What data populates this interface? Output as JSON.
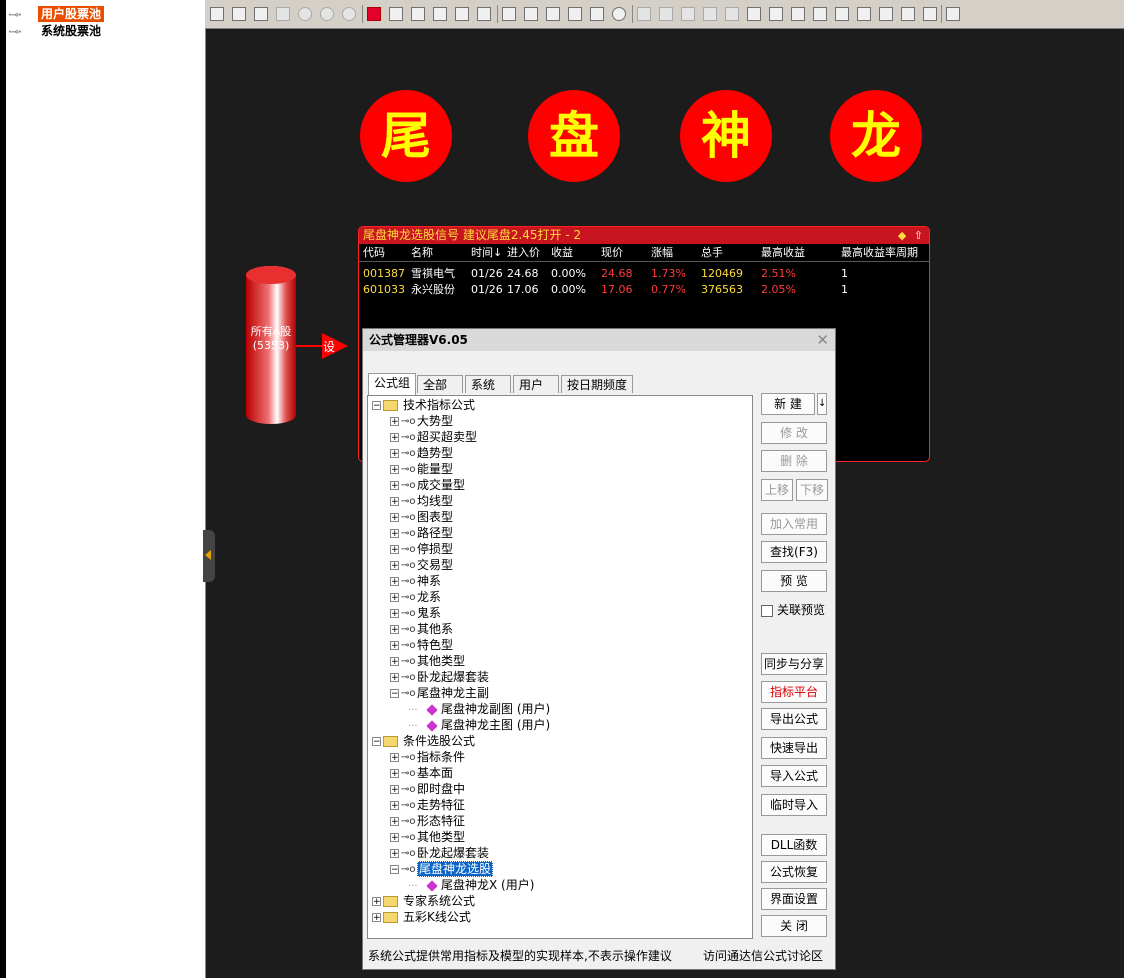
{
  "stock_pools": {
    "items": [
      {
        "label": "用户股票池",
        "selected": true
      },
      {
        "label": "系统股票池",
        "selected": false
      }
    ]
  },
  "toolbar": {
    "icons": [
      "new-icon",
      "open-icon",
      "save-icon",
      "delete-icon",
      "play-icon",
      "pause-icon",
      "stop-icon",
      "pointer-icon",
      "shape-icon",
      "list-icon",
      "triangle-icon",
      "arrow-icon",
      "grid-icon",
      "text-icon",
      "line-icon",
      "rect-icon",
      "rounded-rect-icon",
      "ellipse-icon",
      "circle-icon",
      "copy-icon",
      "paste-icon",
      "clip-icon",
      "fill-icon",
      "color-icon",
      "align-left-icon",
      "align-right-icon",
      "align-top-icon",
      "align-bottom-icon",
      "center-icon",
      "distribute-h-icon",
      "distribute-v-icon",
      "same-width-icon",
      "same-height-icon",
      "chart-icon"
    ]
  },
  "banner": {
    "chars": [
      "尾",
      "盘",
      "神",
      "龙"
    ],
    "color_bg": "#ff0000",
    "color_fg": "#ffff00"
  },
  "result_panel": {
    "title": "尾盘神龙选股信号 建议尾盘2.45打开 - 2",
    "columns": [
      "代码",
      "名称",
      "时间↓",
      "进入价",
      "收益",
      "现价",
      "涨幅",
      "总手",
      "最高收益",
      "最高收益率周期"
    ],
    "rows": [
      {
        "code": "001387",
        "name": "雪祺电气",
        "time": "01/26",
        "entry": "24.68",
        "gain": "0.00%",
        "price": "24.68",
        "change": "1.73%",
        "volume": "120469",
        "max_gain": "2.51%",
        "max_period": "1"
      },
      {
        "code": "601033",
        "name": "永兴股份",
        "time": "01/26",
        "entry": "17.06",
        "gain": "0.00%",
        "price": "17.06",
        "change": "0.77%",
        "volume": "376563",
        "max_gain": "2.05%",
        "max_period": "1"
      }
    ]
  },
  "flow": {
    "source_label": "所有A股",
    "source_count": "(5353)",
    "node_label": "设"
  },
  "dialog": {
    "title": "公式管理器V6.05",
    "tabs": [
      "公式组",
      "全部",
      "系统",
      "用户",
      "按日期频度"
    ],
    "tree": [
      {
        "label": "技术指标公式",
        "level": 0,
        "kind": "folder",
        "expander": "⊟"
      },
      {
        "label": "大势型",
        "level": 1,
        "kind": "key",
        "expander": "⊞"
      },
      {
        "label": "超买超卖型",
        "level": 1,
        "kind": "key",
        "expander": "⊞"
      },
      {
        "label": "趋势型",
        "level": 1,
        "kind": "key",
        "expander": "⊞"
      },
      {
        "label": "能量型",
        "level": 1,
        "kind": "key",
        "expander": "⊞"
      },
      {
        "label": "成交量型",
        "level": 1,
        "kind": "key",
        "expander": "⊞"
      },
      {
        "label": "均线型",
        "level": 1,
        "kind": "key",
        "expander": "⊞"
      },
      {
        "label": "图表型",
        "level": 1,
        "kind": "key",
        "expander": "⊞"
      },
      {
        "label": "路径型",
        "level": 1,
        "kind": "key",
        "expander": "⊞"
      },
      {
        "label": "停损型",
        "level": 1,
        "kind": "key",
        "expander": "⊞"
      },
      {
        "label": "交易型",
        "level": 1,
        "kind": "key",
        "expander": "⊞"
      },
      {
        "label": "神系",
        "level": 1,
        "kind": "key",
        "expander": "⊞"
      },
      {
        "label": "龙系",
        "level": 1,
        "kind": "key",
        "expander": "⊞"
      },
      {
        "label": "鬼系",
        "level": 1,
        "kind": "key",
        "expander": "⊞"
      },
      {
        "label": "其他系",
        "level": 1,
        "kind": "key",
        "expander": "⊞"
      },
      {
        "label": "特色型",
        "level": 1,
        "kind": "key",
        "expander": "⊞"
      },
      {
        "label": "其他类型",
        "level": 1,
        "kind": "key",
        "expander": "⊞"
      },
      {
        "label": "卧龙起爆套装",
        "level": 1,
        "kind": "key",
        "expander": "⊞"
      },
      {
        "label": "尾盘神龙主副",
        "level": 1,
        "kind": "key",
        "expander": "⊟"
      },
      {
        "label": "尾盘神龙副图  (用户)",
        "level": 2,
        "kind": "formula",
        "expander": ""
      },
      {
        "label": "尾盘神龙主图  (用户)",
        "level": 2,
        "kind": "formula",
        "expander": ""
      },
      {
        "label": "条件选股公式",
        "level": 0,
        "kind": "folder",
        "expander": "⊟"
      },
      {
        "label": "指标条件",
        "level": 1,
        "kind": "key",
        "expander": "⊞"
      },
      {
        "label": "基本面",
        "level": 1,
        "kind": "key",
        "expander": "⊞"
      },
      {
        "label": "即时盘中",
        "level": 1,
        "kind": "key",
        "expander": "⊞"
      },
      {
        "label": "走势特征",
        "level": 1,
        "kind": "key",
        "expander": "⊞"
      },
      {
        "label": "形态特征",
        "level": 1,
        "kind": "key",
        "expander": "⊞"
      },
      {
        "label": "其他类型",
        "level": 1,
        "kind": "key",
        "expander": "⊞"
      },
      {
        "label": "卧龙起爆套装",
        "level": 1,
        "kind": "key",
        "expander": "⊞"
      },
      {
        "label": "尾盘神龙选股",
        "level": 1,
        "kind": "key",
        "expander": "⊟",
        "selected": true
      },
      {
        "label": "尾盘神龙X  (用户)",
        "level": 2,
        "kind": "formula",
        "expander": ""
      },
      {
        "label": "专家系统公式",
        "level": 0,
        "kind": "folder",
        "expander": "⊞"
      },
      {
        "label": "五彩K线公式",
        "level": 0,
        "kind": "folder",
        "expander": "⊞"
      }
    ],
    "buttons": {
      "new": "新  建",
      "edit": "修  改",
      "delete": "删  除",
      "move_up": "上移",
      "move_down": "下移",
      "add_common": "加入常用",
      "find": "查找(F3)",
      "preview": "预  览",
      "sync_share": "同步与分享",
      "indicator_platform": "指标平台",
      "export": "导出公式",
      "quick_export": "快速导出",
      "import": "导入公式",
      "temp_import": "临时导入",
      "dll": "DLL函数",
      "restore": "公式恢复",
      "ui_settings": "界面设置",
      "close": "关  闭"
    },
    "linked_preview": "关联预览",
    "status_left": "系统公式提供常用指标及模型的实现样本,不表示操作建议",
    "status_right": "访问通达信公式讨论区"
  }
}
